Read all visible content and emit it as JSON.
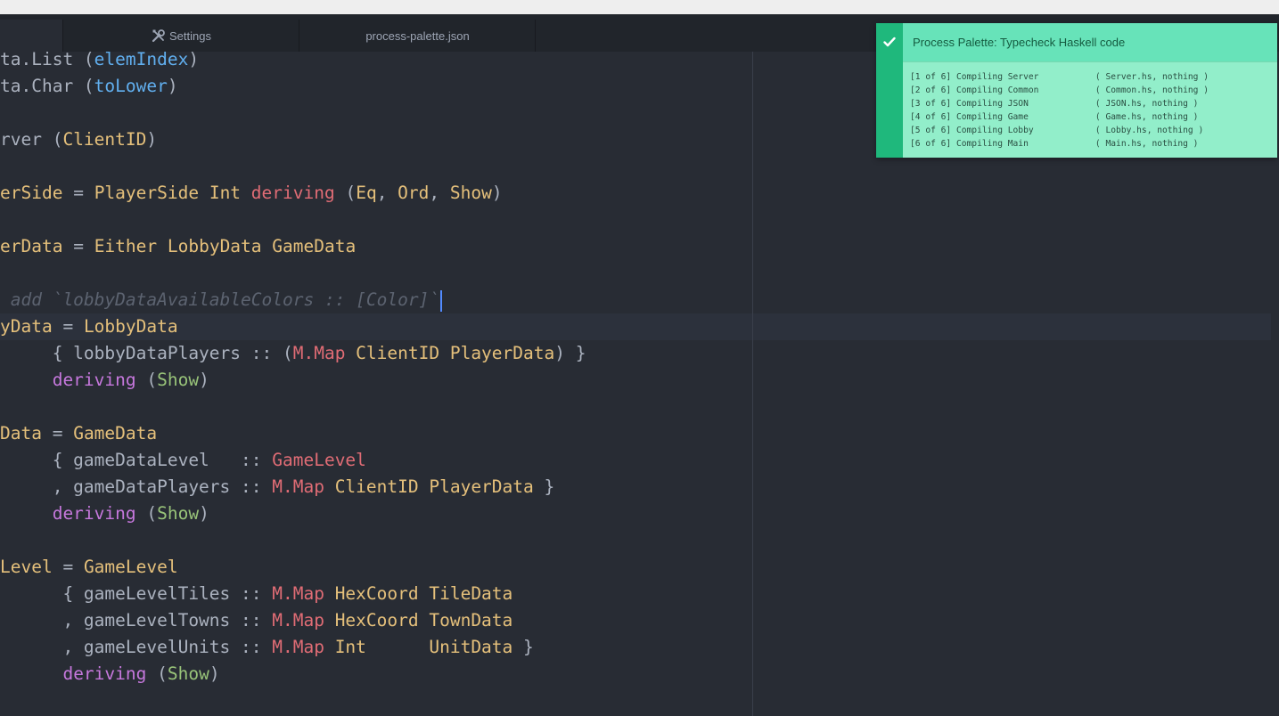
{
  "tabs": [
    {
      "label": ""
    },
    {
      "label": "Settings",
      "icon": "tools-icon"
    },
    {
      "label": "process-palette.json"
    }
  ],
  "code_lines": [
    [
      {
        "t": "ta.List ",
        "c": "p"
      },
      {
        "t": "(",
        "c": "p"
      },
      {
        "t": "elemIndex",
        "c": "f"
      },
      {
        "t": ")",
        "c": "p"
      }
    ],
    [
      {
        "t": "ta.Char ",
        "c": "p"
      },
      {
        "t": "(",
        "c": "p"
      },
      {
        "t": "toLower",
        "c": "f"
      },
      {
        "t": ")",
        "c": "p"
      }
    ],
    [],
    [
      {
        "t": "rver ",
        "c": "p"
      },
      {
        "t": "(",
        "c": "p"
      },
      {
        "t": "ClientID",
        "c": "t"
      },
      {
        "t": ")",
        "c": "p"
      }
    ],
    [],
    [
      {
        "t": "erSide",
        "c": "t"
      },
      {
        "t": " = ",
        "c": "p"
      },
      {
        "t": "PlayerSide Int ",
        "c": "t"
      },
      {
        "t": "deriving",
        "c": "r"
      },
      {
        "t": " (",
        "c": "p"
      },
      {
        "t": "Eq",
        "c": "t"
      },
      {
        "t": ", ",
        "c": "p"
      },
      {
        "t": "Ord",
        "c": "t"
      },
      {
        "t": ", ",
        "c": "p"
      },
      {
        "t": "Show",
        "c": "t"
      },
      {
        "t": ")",
        "c": "p"
      }
    ],
    [],
    [
      {
        "t": "erData",
        "c": "t"
      },
      {
        "t": " = ",
        "c": "p"
      },
      {
        "t": "Either LobbyData GameData",
        "c": "t"
      }
    ],
    [],
    [
      {
        "t": " add `lobbyDataAvailableColors :: [Color]`",
        "c": "c"
      },
      {
        "t": "",
        "c": "caret"
      }
    ],
    [
      {
        "t": "yData",
        "c": "t"
      },
      {
        "t": " = ",
        "c": "p"
      },
      {
        "t": "LobbyData",
        "c": "t"
      }
    ],
    [
      {
        "t": "     { lobbyDataPlayers :: (",
        "c": "p"
      },
      {
        "t": "M.Map",
        "c": "r"
      },
      {
        "t": " ClientID PlayerData",
        "c": "t"
      },
      {
        "t": ") }",
        "c": "p"
      }
    ],
    [
      {
        "t": "     ",
        "c": "p"
      },
      {
        "t": "deriving",
        "c": "k"
      },
      {
        "t": " (",
        "c": "p"
      },
      {
        "t": "Show",
        "c": "g"
      },
      {
        "t": ")",
        "c": "p"
      }
    ],
    [],
    [
      {
        "t": "Data",
        "c": "t"
      },
      {
        "t": " = ",
        "c": "p"
      },
      {
        "t": "GameData",
        "c": "t"
      }
    ],
    [
      {
        "t": "     { gameDataLevel   :: ",
        "c": "p"
      },
      {
        "t": "GameLevel",
        "c": "r"
      }
    ],
    [
      {
        "t": "     , gameDataPlayers :: ",
        "c": "p"
      },
      {
        "t": "M.Map",
        "c": "r"
      },
      {
        "t": " ClientID PlayerData",
        "c": "t"
      },
      {
        "t": " }",
        "c": "p"
      }
    ],
    [
      {
        "t": "     ",
        "c": "p"
      },
      {
        "t": "deriving",
        "c": "k"
      },
      {
        "t": " (",
        "c": "p"
      },
      {
        "t": "Show",
        "c": "g"
      },
      {
        "t": ")",
        "c": "p"
      }
    ],
    [],
    [
      {
        "t": "Level",
        "c": "t"
      },
      {
        "t": " = ",
        "c": "p"
      },
      {
        "t": "GameLevel",
        "c": "t"
      }
    ],
    [
      {
        "t": "      { gameLevelTiles :: ",
        "c": "p"
      },
      {
        "t": "M.Map",
        "c": "r"
      },
      {
        "t": " HexCoord TileData",
        "c": "t"
      }
    ],
    [
      {
        "t": "      , gameLevelTowns :: ",
        "c": "p"
      },
      {
        "t": "M.Map",
        "c": "r"
      },
      {
        "t": " HexCoord TownData",
        "c": "t"
      }
    ],
    [
      {
        "t": "      , gameLevelUnits :: ",
        "c": "p"
      },
      {
        "t": "M.Map",
        "c": "r"
      },
      {
        "t": " Int      UnitData",
        "c": "t"
      },
      {
        "t": " }",
        "c": "p"
      }
    ],
    [
      {
        "t": "      ",
        "c": "p"
      },
      {
        "t": "deriving",
        "c": "k"
      },
      {
        "t": " (",
        "c": "p"
      },
      {
        "t": "Show",
        "c": "g"
      },
      {
        "t": ")",
        "c": "p"
      }
    ]
  ],
  "notification": {
    "title": "Process Palette: Typecheck Haskell code",
    "icon": "check-icon",
    "accent": "#1fb87c",
    "detail": "[1 of 6] Compiling Server           ( Server.hs, nothing )\n[2 of 6] Compiling Common           ( Common.hs, nothing )\n[3 of 6] Compiling JSON             ( JSON.hs, nothing )\n[4 of 6] Compiling Game             ( Game.hs, nothing )\n[5 of 6] Compiling Lobby            ( Lobby.hs, nothing )\n[6 of 6] Compiling Main             ( Main.hs, nothing )"
  }
}
